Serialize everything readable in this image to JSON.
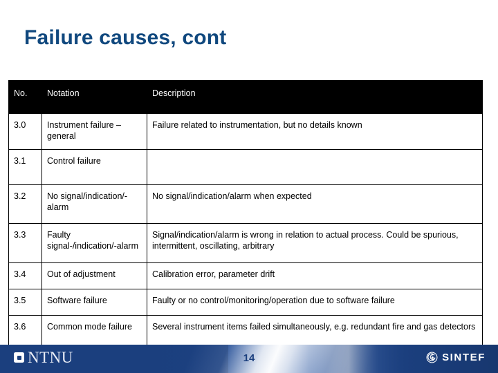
{
  "slide": {
    "title": "Failure causes, cont",
    "title_color": "#10487e"
  },
  "table": {
    "headers": {
      "no": "No.",
      "notation": "Notation",
      "description": "Description"
    },
    "rows": [
      {
        "no": "3.0",
        "notation": "Instrument failure – general",
        "description": "Failure related to instrumentation, but no details known"
      },
      {
        "no": "3.1",
        "notation": "Control failure",
        "description": ""
      },
      {
        "no": "3.2",
        "notation": "No signal/indication/-alarm",
        "description": "No signal/indication/alarm when expected"
      },
      {
        "no": "3.3",
        "notation": "Faulty signal-/indication/-alarm",
        "description": "Signal/indication/alarm is wrong in relation to actual process. Could be spurious, intermittent, oscillating, arbitrary"
      },
      {
        "no": "3.4",
        "notation": "Out of adjustment",
        "description": "Calibration error, parameter drift"
      },
      {
        "no": "3.5",
        "notation": "Software failure",
        "description": "Faulty or no control/monitoring/operation due to software failure"
      },
      {
        "no": "3.6",
        "notation": "Common mode failure",
        "description": "Several instrument items failed simultaneously, e.g. redundant fire and gas detectors"
      }
    ]
  },
  "footer": {
    "ntnu_label": "NTNU",
    "page_number": "14",
    "sintef_label": "SINTEF",
    "band_color": "#1b3f7e"
  }
}
